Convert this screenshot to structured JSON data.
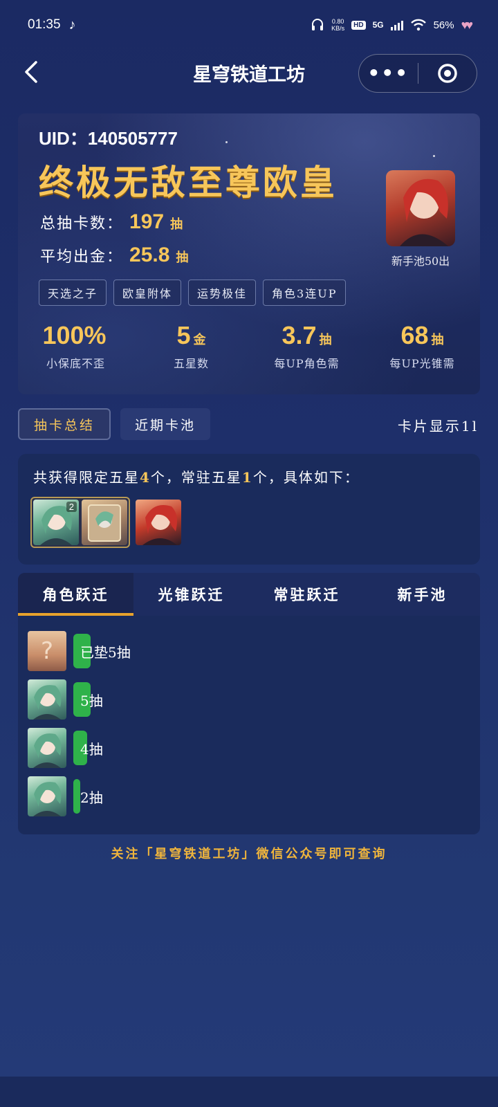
{
  "status_bar": {
    "time": "01:35",
    "network_speed_value": "0.80",
    "network_speed_unit": "KB/s",
    "hd_label": "HD",
    "signal_label": "5G",
    "battery": "56%"
  },
  "nav": {
    "title": "星穹铁道工坊",
    "more_label": "•••"
  },
  "profile": {
    "uid_label": "UID：",
    "uid": "140505777",
    "rank_title": "终极无敌至尊欧皇",
    "total_pulls_label": "总抽卡数：",
    "total_pulls": "197",
    "average_label": "平均出金：",
    "average": "25.8",
    "pull_unit": "抽",
    "featured_caption": "新手池50出",
    "tags": [
      "天选之子",
      "欧皇附体",
      "运势极佳",
      "角色3连UP"
    ]
  },
  "metrics": [
    {
      "value": "100%",
      "unit": "",
      "label": "小保底不歪"
    },
    {
      "value": "5",
      "unit": "金",
      "label": "五星数"
    },
    {
      "value": "3.7",
      "unit": "抽",
      "label": "每UP角色需"
    },
    {
      "value": "68",
      "unit": "抽",
      "label": "每UP光锥需"
    }
  ],
  "tabs": {
    "summary": "抽卡总结",
    "recent": "近期卡池",
    "card_toggle": "卡片显示1l"
  },
  "summary": {
    "prefix": "共获得限定五星",
    "limited_count": "4",
    "middle": "个，常驻五星",
    "standard_count": "1",
    "suffix": "个，具体如下：",
    "group_badge": "2"
  },
  "history_tabs": [
    "角色跃迁",
    "光锥跃迁",
    "常驻跃迁",
    "新手池"
  ],
  "history_rows": [
    {
      "thumb": "unknown",
      "label": "已垫5抽",
      "bar_fraction": 0.4
    },
    {
      "thumb": "green",
      "label": "5抽",
      "bar_fraction": 0.4
    },
    {
      "thumb": "green",
      "label": "4抽",
      "bar_fraction": 0.32
    },
    {
      "thumb": "green",
      "label": "2抽",
      "bar_fraction": 0.16
    }
  ],
  "unknown_glyph": "?",
  "footer_note": "关注「星穹铁道工坊」微信公众号即可查询",
  "colors": {
    "accent_gold": "#f7c65a",
    "bar_green": "#2fb24a",
    "tab_underline": "#e8a22c"
  }
}
